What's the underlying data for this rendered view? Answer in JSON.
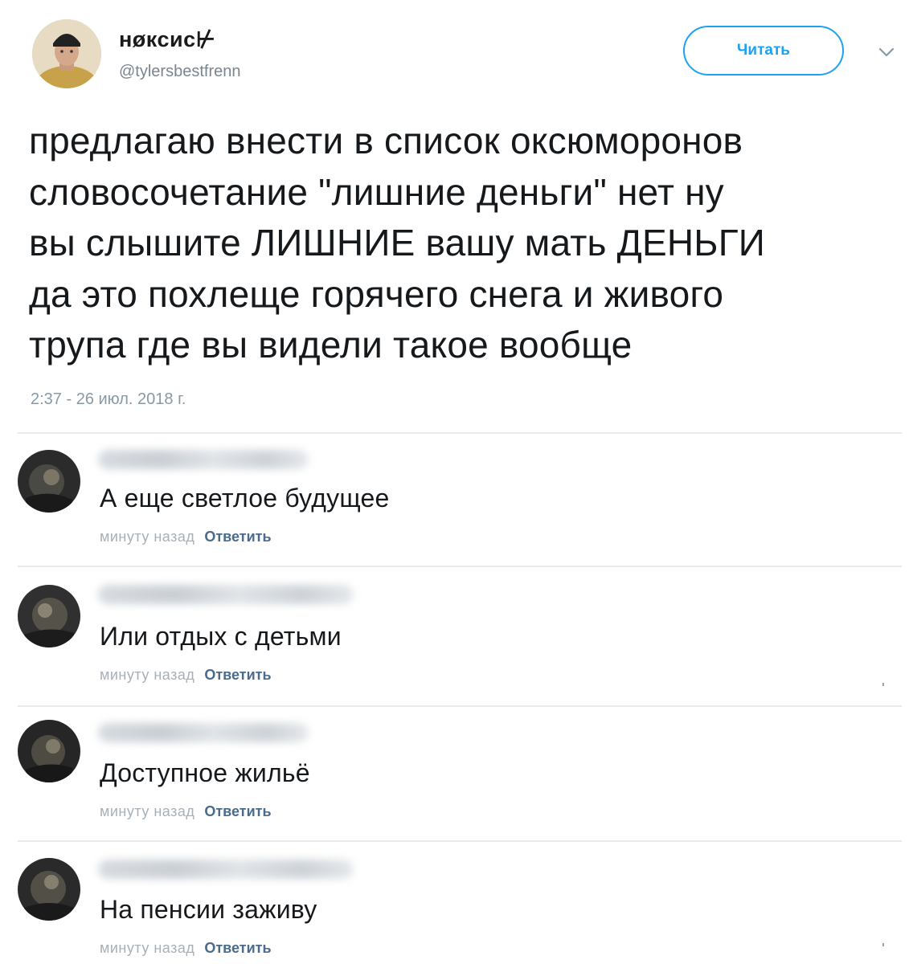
{
  "tweet": {
    "author_name": "нøксис⊬",
    "author_handle": "@tylersbestfrenn",
    "follow_label": "Читать",
    "text_lines": [
      "предлагаю внести в список оксюморонов",
      "словосочетание \"лишние деньги\" нет ну",
      "вы слышите ЛИШНИЕ вашу мать ДЕНЬГИ",
      "да это похлеще горячего снега и живого",
      "трупа где вы видели такое вообще"
    ],
    "timestamp": "2:37 - 26 июл. 2018 г."
  },
  "comments": [
    {
      "text": "А еще светлое будущее",
      "time": "минуту назад",
      "reply_label": "Ответить"
    },
    {
      "text": "Или отдых с детьми",
      "time": "минуту назад",
      "reply_label": "Ответить"
    },
    {
      "text": "Доступное жильё",
      "time": "минуту назад",
      "reply_label": "Ответить"
    },
    {
      "text": "На пенсии заживу",
      "time": "минуту назад",
      "reply_label": "Ответить"
    }
  ],
  "icons": {
    "chevron": "chevron-down-icon",
    "avatar": "avatar"
  },
  "colors": {
    "accent": "#1da1f2",
    "reply_link": "#4a6b8c",
    "muted": "#8899a6"
  }
}
